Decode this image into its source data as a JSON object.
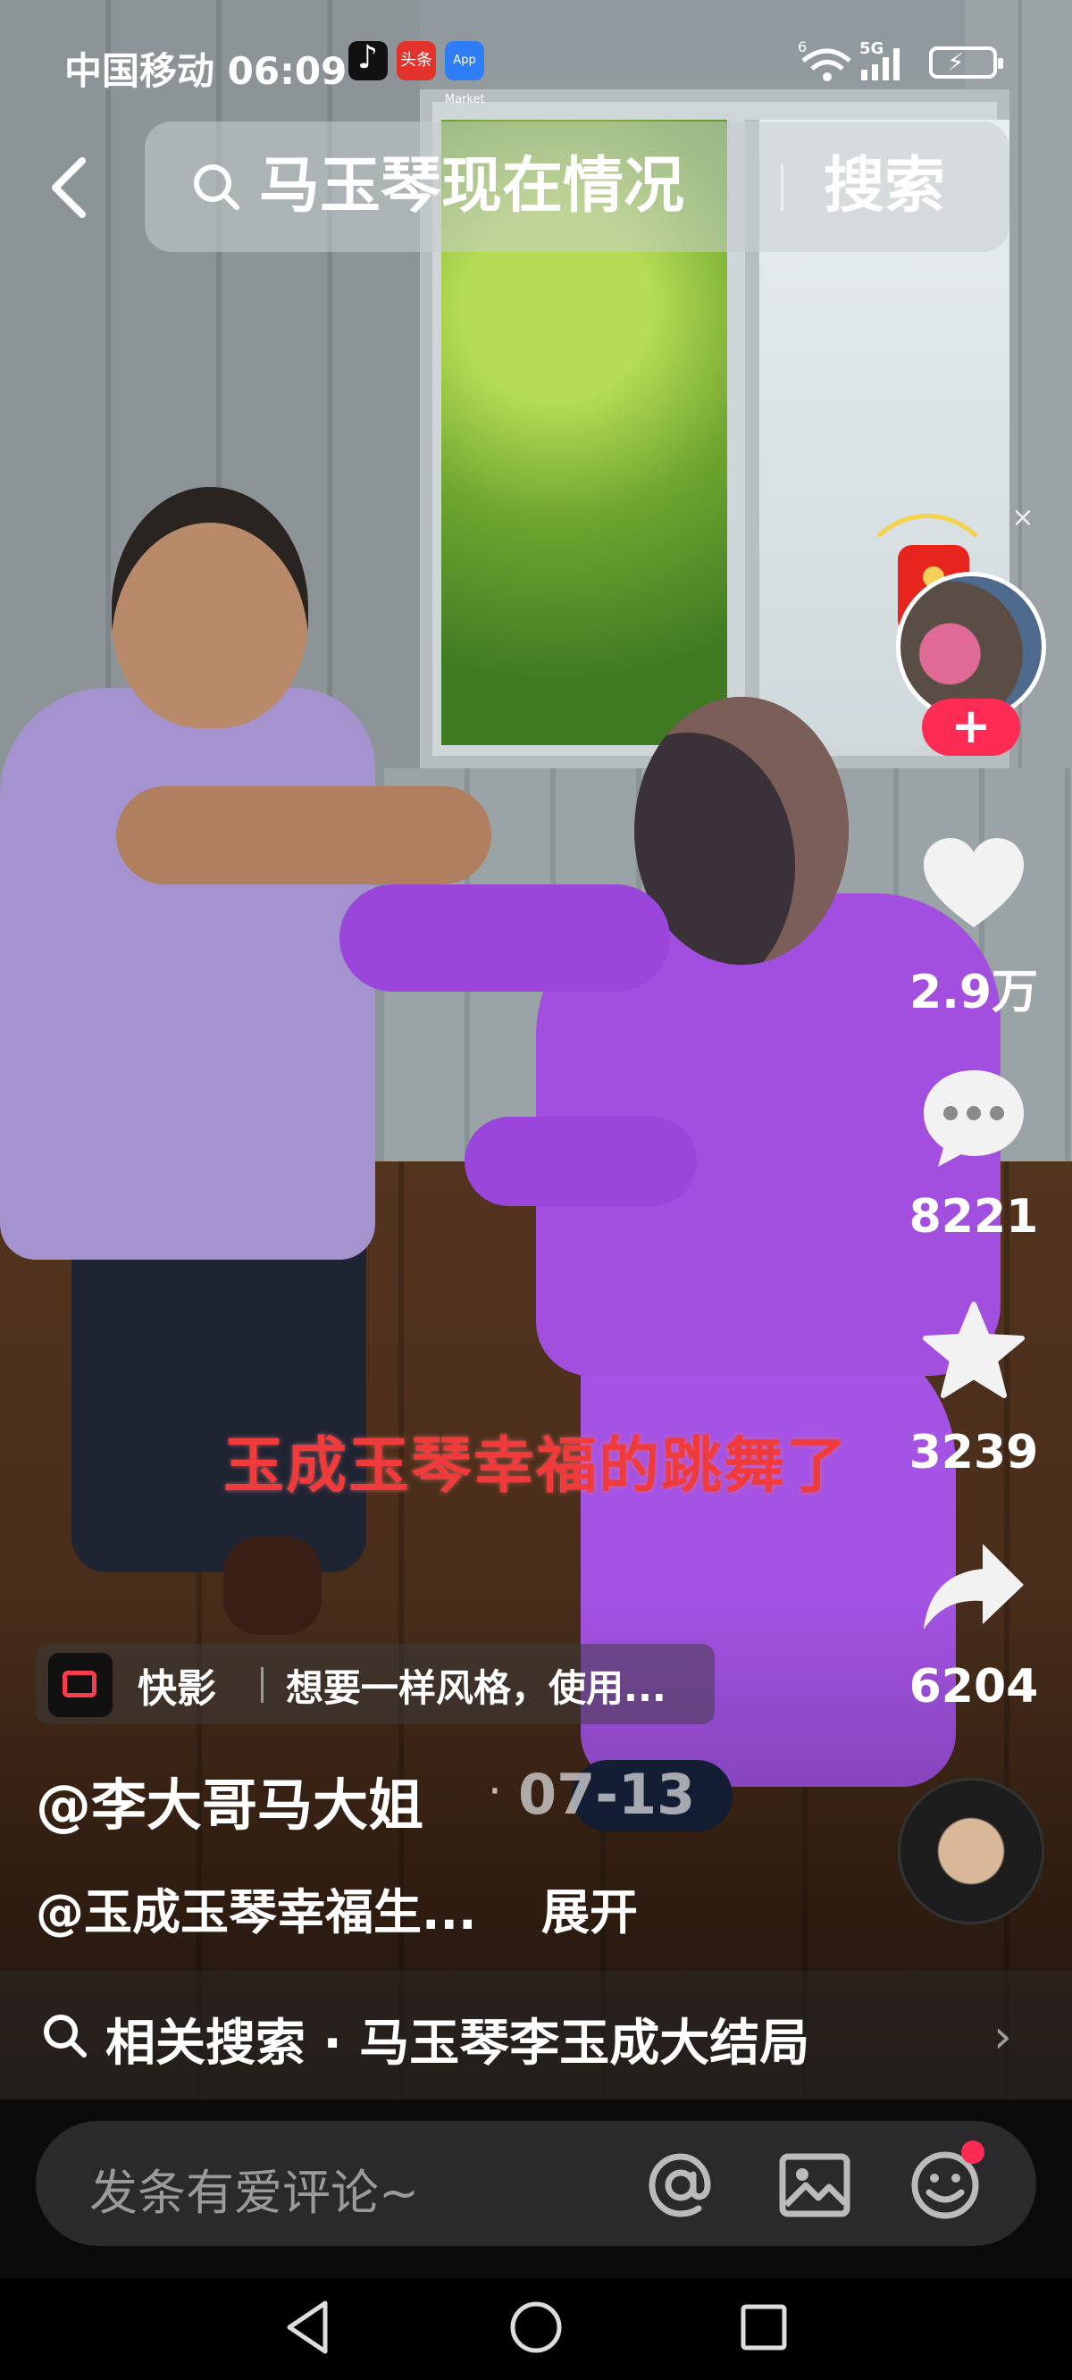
{
  "status_bar": {
    "carrier_time": "中国移动 06:09",
    "app_icons": [
      "tiktok-icon",
      "toutiao-icon",
      "app-gallery-icon"
    ],
    "toutiao_label": "头条",
    "app_gallery_label": "App Market",
    "wifi_badge": "6",
    "network": "5G"
  },
  "search": {
    "query": "马玉琴现在情况",
    "button_label": "搜索"
  },
  "video": {
    "caption": "玉成玉琴幸福的跳舞了"
  },
  "rail": {
    "close": "×",
    "follow": "+",
    "likes": "2.9万",
    "comments": "8221",
    "favorites": "3239",
    "shares": "6204"
  },
  "template": {
    "name": "快影",
    "text": "想要一样风格，使用..."
  },
  "post": {
    "author": "@李大哥马大姐",
    "dot": "·",
    "date": "07-13",
    "description": "@玉成玉琴幸福生...",
    "expand": "展开"
  },
  "related": {
    "text": "相关搜索 · 马玉琴李玉成大结局"
  },
  "comment": {
    "placeholder": "发条有爱评论~"
  },
  "colors": {
    "accent": "#fe2c55",
    "caption": "#ef3b3b"
  }
}
